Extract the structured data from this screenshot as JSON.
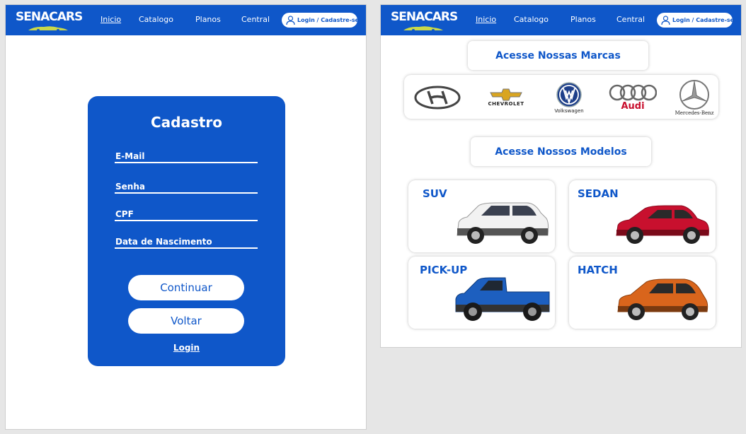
{
  "nav": {
    "logo_text": "SENACARS",
    "links": [
      "Inicio",
      "Catalogo",
      "Planos",
      "Central"
    ],
    "login_label": "Login / Cadastre-se"
  },
  "signup": {
    "title": "Cadastro",
    "fields": [
      {
        "placeholder": "E-Mail",
        "value": ""
      },
      {
        "placeholder": "Senha",
        "value": ""
      },
      {
        "placeholder": "CPF",
        "value": ""
      },
      {
        "placeholder": "Data de Nascimento",
        "value": ""
      }
    ],
    "continue_label": "Continuar",
    "back_label": "Voltar",
    "login_link": "Login"
  },
  "home": {
    "brands_title": "Acesse Nossas Marcas",
    "brands": [
      "Hyundai",
      "CHEVROLET",
      "Volkswagen",
      "Audi",
      "Mercedes-Benz"
    ],
    "models_title": "Acesse Nossos Modelos",
    "models": [
      {
        "label": "SUV",
        "car_color": "#f2f2f2"
      },
      {
        "label": "SEDAN",
        "car_color": "#c8102e"
      },
      {
        "label": "PICK-UP",
        "car_color": "#1d5fbf"
      },
      {
        "label": "HATCH",
        "car_color": "#d9651c"
      }
    ]
  },
  "colors": {
    "brand_blue": "#0f57c9",
    "background": "#e6e6e6"
  }
}
